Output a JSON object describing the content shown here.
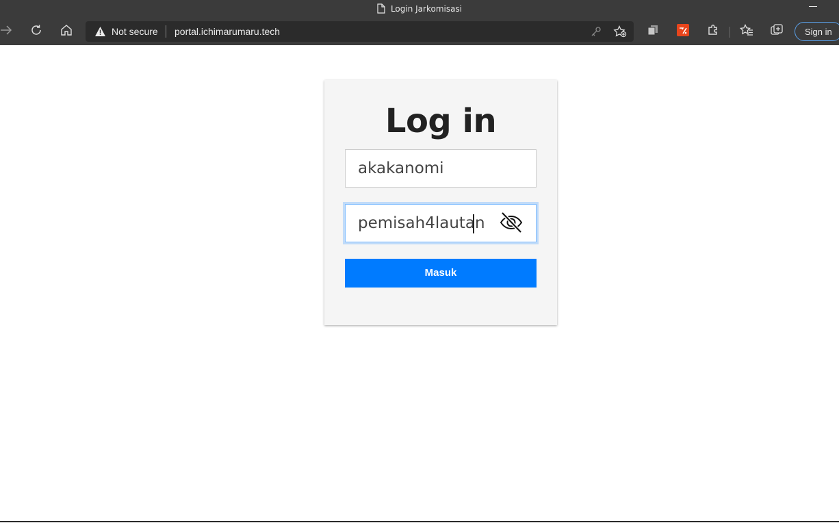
{
  "window": {
    "title": "Login Jarkomisasi"
  },
  "toolbar": {
    "security_label": "Not secure",
    "url": "portal.ichimarumaru.tech",
    "signin_label": "Sign in"
  },
  "login": {
    "heading": "Log in",
    "username_value": "akakanomi",
    "password_value": "pemisah4lautan",
    "submit_label": "Masuk"
  },
  "colors": {
    "chrome_bg": "#3b3b3b",
    "accent": "#007bff",
    "card_bg": "#f5f5f5",
    "focus_ring": "#80bdff"
  },
  "icons": [
    "page-icon",
    "forward-icon",
    "refresh-icon",
    "home-icon",
    "warning-icon",
    "key-icon",
    "add-favorite-icon",
    "collections-icon",
    "extension-red-icon",
    "extensions-icon",
    "favorites-icon",
    "tab-actions-icon",
    "eye-slash-icon"
  ]
}
